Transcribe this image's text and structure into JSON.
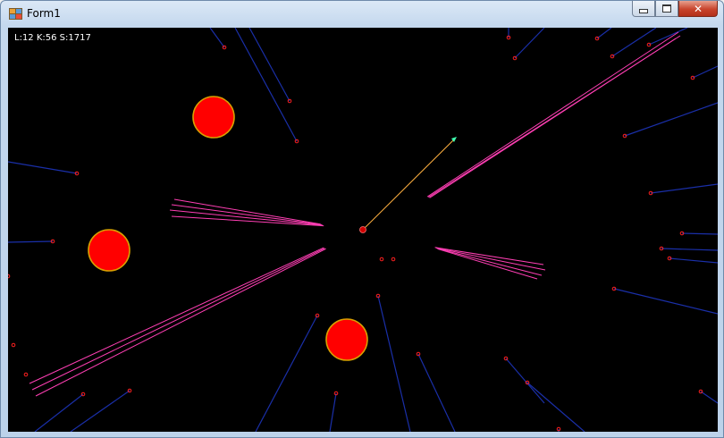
{
  "window": {
    "title": "Form1",
    "icon": "winforms-app-icon",
    "controls": [
      "minimize-icon",
      "maximize-icon",
      "close-icon"
    ],
    "close_glyph": "✕"
  },
  "hud": {
    "status": "L:12 K:56 S:1717"
  },
  "colors": {
    "background": "#000000",
    "planet_fill": "#ff0000",
    "planet_stroke": "#d9a000",
    "enemy": "#ff2020",
    "enemy_trail": "#1a2fa8",
    "laser": "#ff3fb4",
    "aim": "#ffb040",
    "aim_tip": "#40ffb0",
    "ship": "#d00000"
  },
  "game": {
    "planets": 3,
    "laser_volleys": 4,
    "enemies": 46
  }
}
